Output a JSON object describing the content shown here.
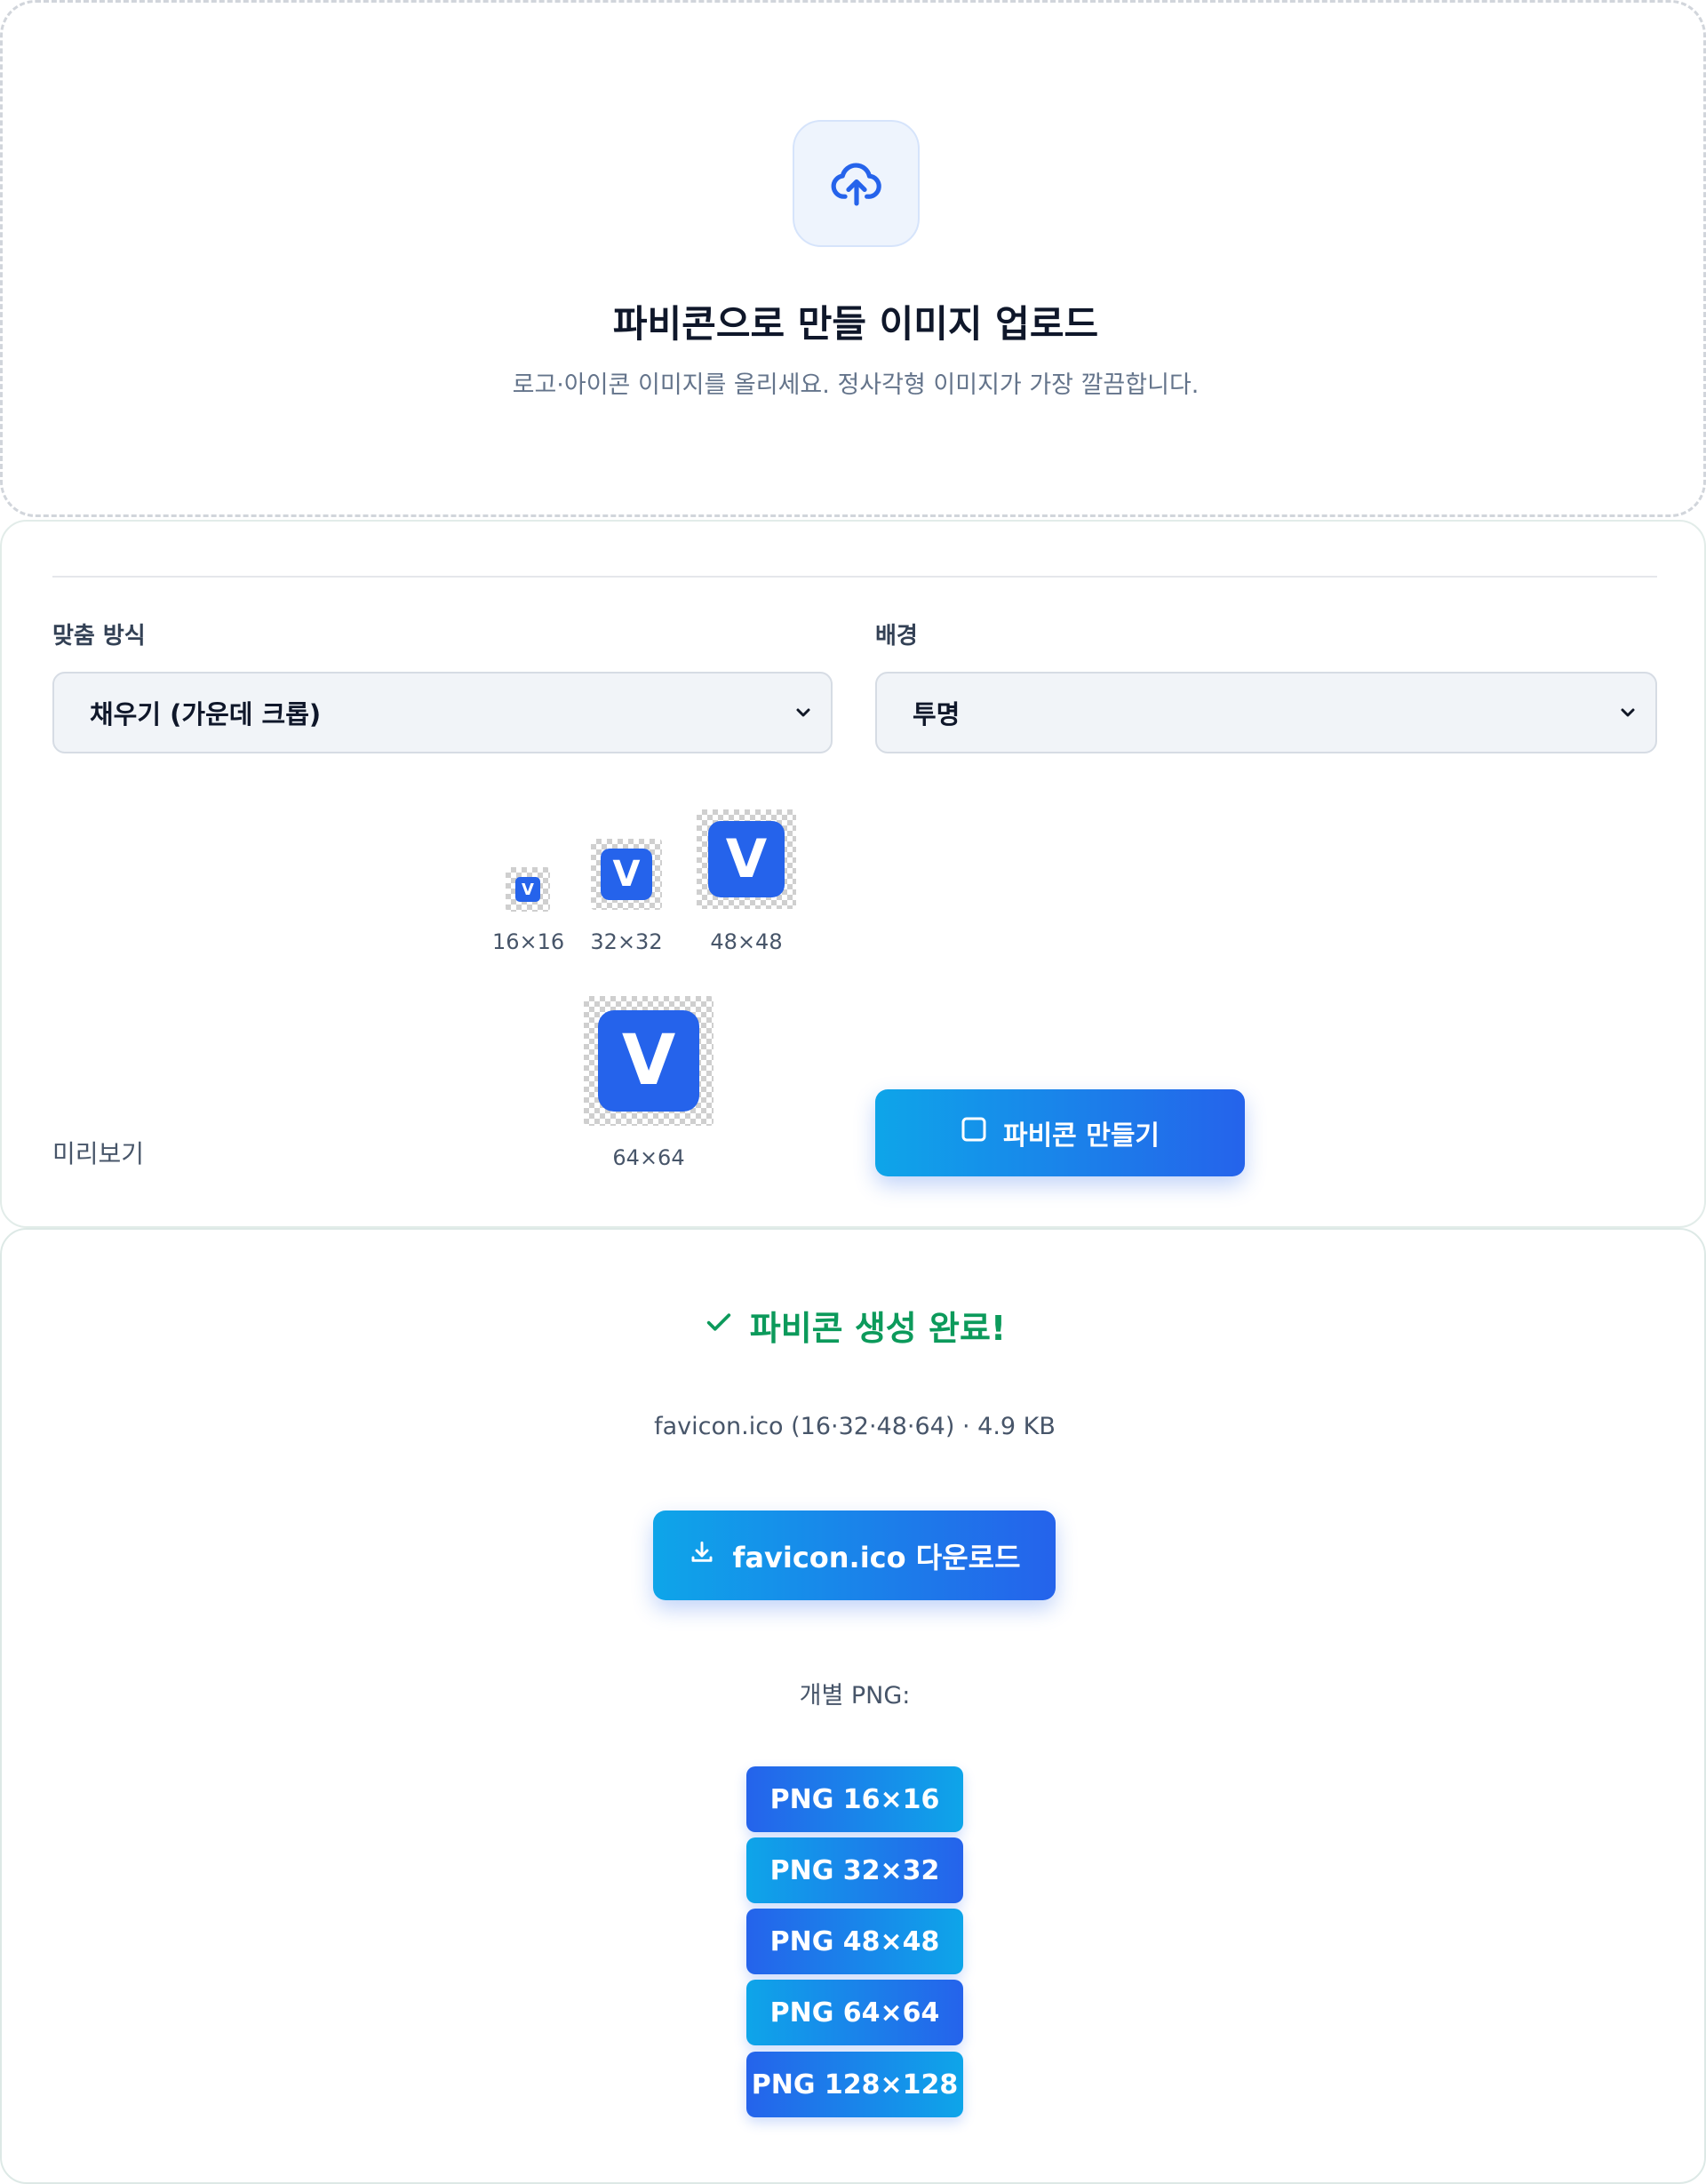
{
  "upload": {
    "icon": "cloud-upload-icon",
    "title": "파비콘으로 만들 이미지 업로드",
    "subtitle": "로고·아이콘 이미지를 올리세요. 정사각형 이미지가 가장 깔끔합니다."
  },
  "options": {
    "fit_label": "맞춤 방식",
    "fit_value": "채우기 (가운데 크롭)",
    "background_label": "배경",
    "background_value": "투명",
    "preview_label": "미리보기",
    "preview_glyph": "V",
    "preview_sizes": [
      "16×16",
      "32×32",
      "48×48",
      "64×64"
    ],
    "make_button": "파비콘 만들기",
    "accent_color": "#2563eb"
  },
  "result": {
    "done_text": "파비콘 생성 완료!",
    "done_color": "#0c9a5b",
    "file_info": "favicon.ico (16·32·48·64) · 4.9 KB",
    "download_button": "favicon.ico 다운로드",
    "png_label": "개별 PNG:",
    "png_buttons": [
      "PNG 16×16",
      "PNG 32×32",
      "PNG 48×48",
      "PNG 64×64",
      "PNG 128×128"
    ]
  }
}
